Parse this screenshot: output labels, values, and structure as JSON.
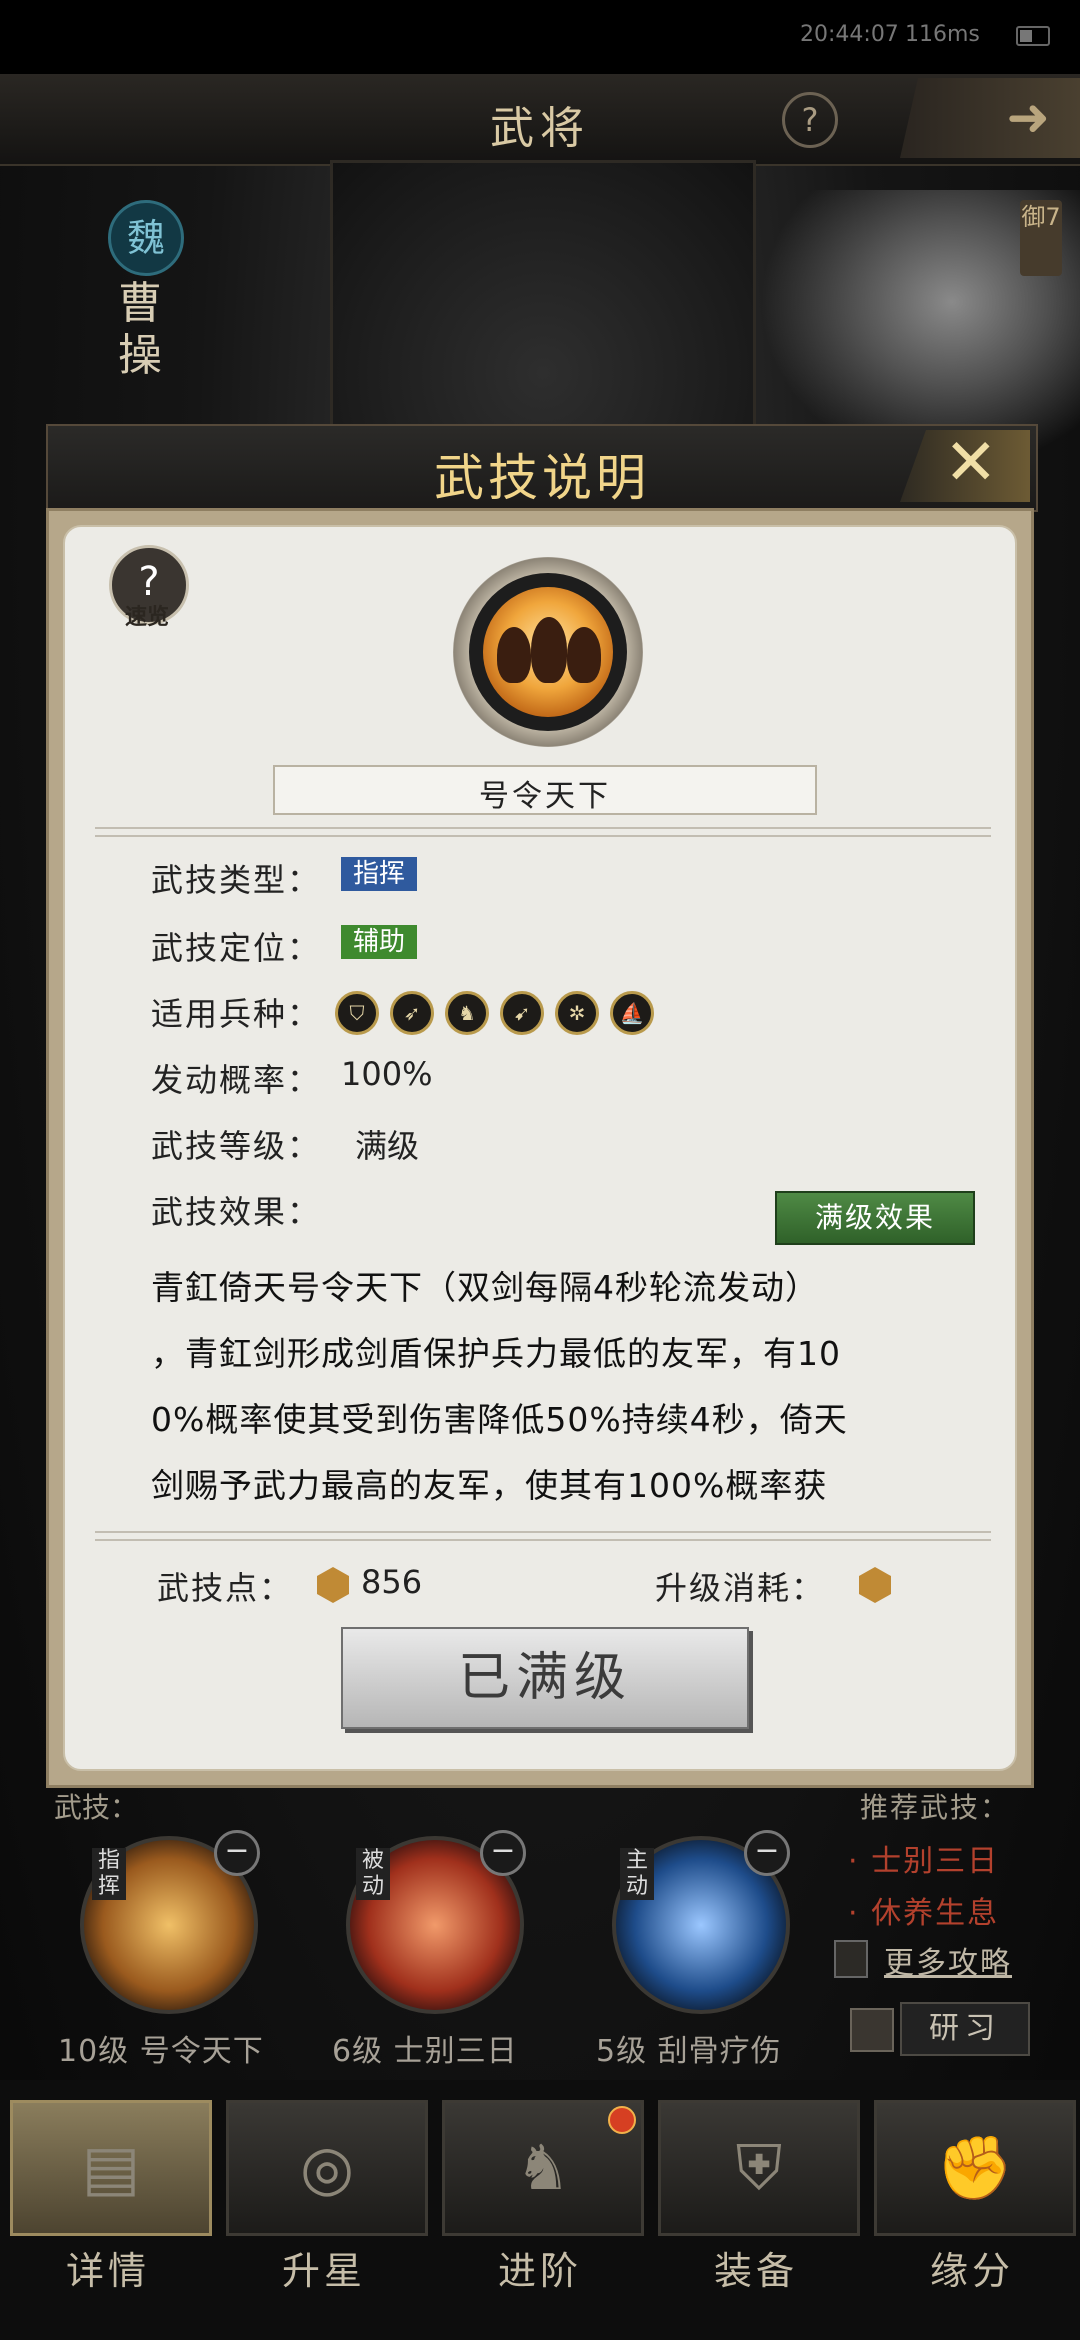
{
  "status": {
    "time": "20:44:07",
    "ping": "116ms"
  },
  "header": {
    "title": "武将",
    "help": "?",
    "back_arrow": "➜"
  },
  "general": {
    "faction": "魏",
    "name": "曹操",
    "defense": "御7"
  },
  "modal": {
    "title": "武技说明",
    "close": "✕",
    "tips_label": "速览",
    "skill_name": "号令天下",
    "rows": {
      "type_label": "武技类型：",
      "type_value": "指挥",
      "role_label": "武技定位：",
      "role_value": "辅助",
      "troops_label": "适用兵种：",
      "rate_label": "发动概率：",
      "rate_value": "100%",
      "level_label": "武技等级：",
      "level_value": "满级",
      "effect_label": "武技效果："
    },
    "troop_icons": [
      "shield-icon",
      "spear-icon",
      "horse-icon",
      "bow-icon",
      "wheel-icon",
      "boat-icon"
    ],
    "max_effect_button": "满级效果",
    "effect_lines": [
      "青釭倚天号令天下（双剑每隔4秒轮流发动）",
      "，青釭剑形成剑盾保护兵力最低的友军，有10",
      "0%概率使其受到伤害降低50%持续4秒，倚天",
      "剑赐予武力最高的友军，使其有100%概率获"
    ],
    "points_label": "武技点：",
    "points_value": "856",
    "cost_label": "升级消耗：",
    "max_level_button": "已满级",
    "colors": {
      "type_tag": "#2f5a9e",
      "role_tag": "#3e8a2e",
      "title": "#f1d58a"
    }
  },
  "lower": {
    "skills_label": "武技：",
    "recommend_label": "推荐武技：",
    "slots": [
      {
        "type": "指挥",
        "label": "10级 号令天下"
      },
      {
        "type": "被动",
        "label": "6级 士别三日"
      },
      {
        "type": "主动",
        "label": "5级 刮骨疗伤"
      }
    ],
    "recommended": [
      "· 士别三日",
      "· 休养生息"
    ],
    "more_guides": "更多攻略",
    "research": "研习"
  },
  "nav": [
    "详情",
    "升星",
    "进阶",
    "装备",
    "缘分"
  ]
}
